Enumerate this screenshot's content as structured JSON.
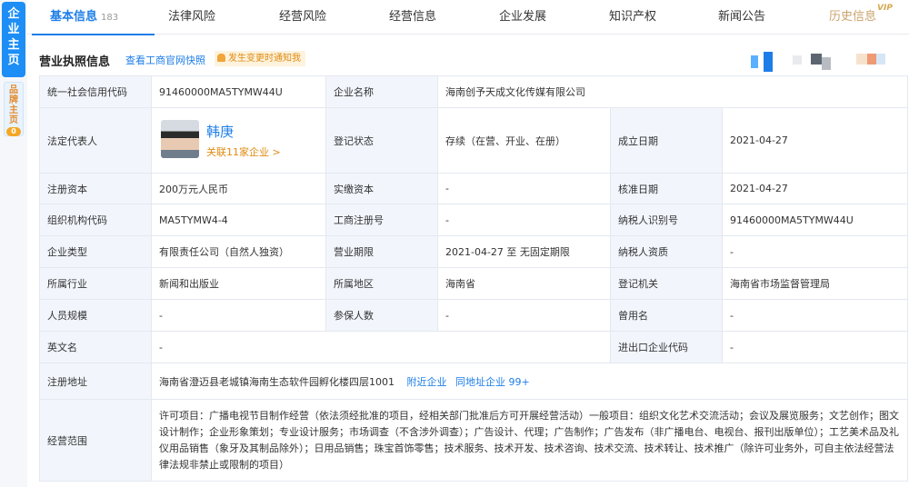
{
  "side": {
    "main_tab": "企业主页",
    "brand_tab": "品牌主页",
    "brand_count": "0"
  },
  "tabs": [
    {
      "label": "基本信息",
      "badge": "183"
    },
    {
      "label": "法律风险"
    },
    {
      "label": "经营风险"
    },
    {
      "label": "经营信息"
    },
    {
      "label": "企业发展"
    },
    {
      "label": "知识产权"
    },
    {
      "label": "新闻公告"
    },
    {
      "label": "历史信息"
    }
  ],
  "vip": "VIP",
  "section": {
    "title": "营业执照信息",
    "snapshot_link": "查看工商官网快照",
    "notify": "发生变更时通知我"
  },
  "info": {
    "credit_code_label": "统一社会信用代码",
    "credit_code": "91460000MA5TYMW44U",
    "company_name_label": "企业名称",
    "company_name": "海南创予天成文化传媒有限公司",
    "legal_rep_label": "法定代表人",
    "legal_rep_name": "韩庚",
    "legal_rep_link": "关联11家企业 >",
    "reg_status_label": "登记状态",
    "reg_status": "存续（在营、开业、在册）",
    "founded_label": "成立日期",
    "founded": "2021-04-27",
    "capital_label": "注册资本",
    "capital": "200万元人民币",
    "paid_capital_label": "实缴资本",
    "paid_capital": "-",
    "approval_date_label": "核准日期",
    "approval_date": "2021-04-27",
    "org_code_label": "组织机构代码",
    "org_code": "MA5TYMW4-4",
    "reg_no_label": "工商注册号",
    "reg_no": "-",
    "taxpayer_id_label": "纳税人识别号",
    "taxpayer_id": "91460000MA5TYMW44U",
    "type_label": "企业类型",
    "type": "有限责任公司（自然人独资）",
    "term_label": "营业期限",
    "term": "2021-04-27 至 无固定期限",
    "taxpayer_qual_label": "纳税人资质",
    "taxpayer_qual": "-",
    "industry_label": "所属行业",
    "industry": "新闻和出版业",
    "region_label": "所属地区",
    "region": "海南省",
    "authority_label": "登记机关",
    "authority": "海南省市场监督管理局",
    "staff_label": "人员规模",
    "staff": "-",
    "insured_label": "参保人数",
    "insured": "-",
    "former_name_label": "曾用名",
    "former_name": "-",
    "english_label": "英文名",
    "english": "-",
    "import_export_label": "进出口企业代码",
    "import_export": "-",
    "address_label": "注册地址",
    "address": "海南省澄迈县老城镇海南生态软件园孵化楼四层1001",
    "nearby_link": "附近企业",
    "same_address_link": "同地址企业 99+",
    "scope_label": "经营范围",
    "scope": "许可项目：广播电视节目制作经营（依法须经批准的项目，经相关部门批准后方可开展经营活动）一般项目：组织文化艺术交流活动；会议及展览服务；文艺创作；图文设计制作；企业形象策划；专业设计服务；市场调查（不含涉外调查）；广告设计、代理；广告制作；广告发布（非广播电台、电视台、报刊出版单位）；工艺美术品及礼仪用品销售（象牙及其制品除外）；日用品销售；珠宝首饰零售；技术服务、技术开发、技术咨询、技术交流、技术转让、技术推广（除许可业务外，可自主依法经营法律法规非禁止或限制的项目）"
  }
}
